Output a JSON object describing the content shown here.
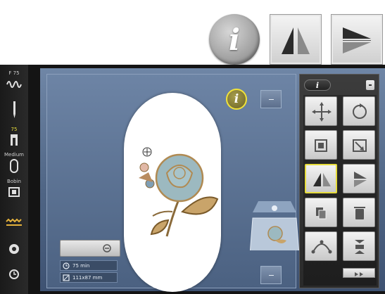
{
  "top_buttons": {
    "info_label": "i",
    "mirror_lr_icon": "mirror-left-right-icon",
    "mirror_ud_icon": "mirror-up-down-icon"
  },
  "sidebar": {
    "tension_value": "F 75",
    "needle_size": "75",
    "foot_label": "Medium",
    "hoop_label": "Bobin"
  },
  "canvas": {
    "info_label": "i",
    "stitch_time": "75 min",
    "design_size": "111x87 mm"
  },
  "panel": {
    "info_label": "i",
    "buttons": [
      {
        "icon": "move-icon"
      },
      {
        "icon": "rotate-icon"
      },
      {
        "icon": "resize-icon"
      },
      {
        "icon": "scale-proportional-icon"
      },
      {
        "icon": "mirror-left-right-icon"
      },
      {
        "icon": "mirror-up-down-icon"
      },
      {
        "icon": "duplicate-icon"
      },
      {
        "icon": "delete-icon"
      },
      {
        "icon": "curve-icon"
      },
      {
        "icon": "stitch-density-icon"
      }
    ]
  },
  "colors": {
    "screen_blue": "#5a7090",
    "active_yellow": "#e6dc3c",
    "flower_blue": "#9cb9c0",
    "flower_brown": "#b08a52"
  }
}
